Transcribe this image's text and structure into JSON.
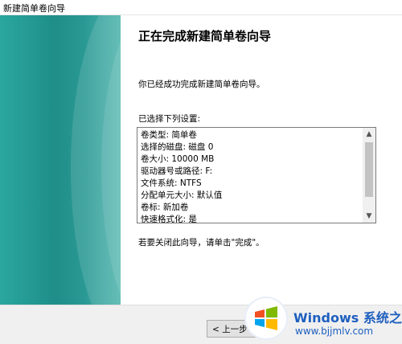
{
  "window": {
    "title": "新建简单卷向导"
  },
  "content": {
    "heading": "正在完成新建简单卷向导",
    "intro": "你已经成功完成新建简单卷向导。",
    "settings_label": "已选择下列设置:",
    "settings": [
      "卷类型: 简单卷",
      "选择的磁盘: 磁盘 0",
      "卷大小: 10000 MB",
      "驱动器号或路径: F:",
      "文件系统: NTFS",
      "分配单元大小: 默认值",
      "卷标: 新加卷",
      "快速格式化: 是"
    ],
    "outro": "若要关闭此向导，请单击\"完成\"。"
  },
  "footer": {
    "back_label": "< 上一步"
  },
  "watermark": {
    "brand": "Windows",
    "brand_suffix": "系统之家",
    "url": "www.bjjmlv.com"
  },
  "colors": {
    "banner": "#1f8e88",
    "watermark_blue": "#1e5fbf"
  }
}
